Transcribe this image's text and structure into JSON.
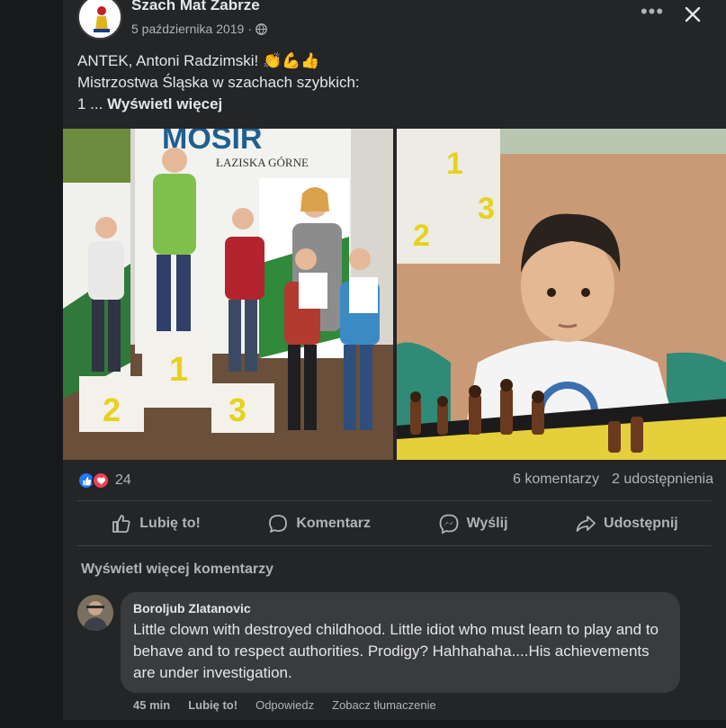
{
  "post": {
    "page_name": "Szach Mat Zabrze",
    "date": "5 października 2019",
    "separator": "·",
    "text_line1": "ANTEK, Antoni Radzimski! 👏💪👍",
    "text_line2": "Mistrzostwa Śląska w szachach szybkich:",
    "text_line3": "1 ...",
    "see_more": "Wyświetl więcej"
  },
  "photos": {
    "left_banner_top": "MOSIR",
    "left_banner_sub": "ŁAZISKA GÓRNE",
    "podium_1": "1",
    "podium_2": "2",
    "podium_3": "3"
  },
  "reactions": {
    "count": "24",
    "comments": "6 komentarzy",
    "shares": "2 udostępnienia"
  },
  "actions": {
    "like": "Lubię to!",
    "comment": "Komentarz",
    "send": "Wyślij",
    "share": "Udostępnij"
  },
  "comments_section": {
    "view_more": "Wyświetl więcej komentarzy",
    "author": "Boroljub Zlatanovic",
    "text": "Little clown with destroyed childhood. Little idiot who must learn to play and to behave and to respect authorities. Prodigy? Hahhahaha....His achievements are under investigation.",
    "time": "45 min",
    "like": "Lubię to!",
    "reply": "Odpowiedz",
    "translate": "Zobacz tłumaczenie"
  },
  "colors": {
    "background": "#18191a",
    "card": "#242526",
    "bubble": "#3a3b3c",
    "like_blue": "#2078f4",
    "love_red": "#f33e58"
  }
}
